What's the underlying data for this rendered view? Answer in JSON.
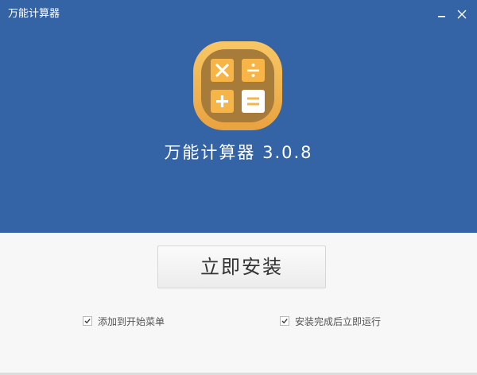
{
  "window": {
    "title": "万能计算器",
    "minimize_icon": "minimize-icon",
    "close_icon": "close-icon"
  },
  "header": {
    "logo_icon": "calculator-app-icon",
    "product_title": "万能计算器 3.0.8"
  },
  "main": {
    "install_label": "立即安装",
    "options": [
      {
        "label": "添加到开始菜单",
        "checked": true
      },
      {
        "label": "安装完成后立即运行",
        "checked": true
      }
    ]
  },
  "colors": {
    "header_bg": "#3463a6",
    "logo_frame": "#f3b551",
    "logo_inner": "#a77b3a",
    "logo_key": "#f7b548",
    "logo_key_equals": "#ffffff"
  }
}
